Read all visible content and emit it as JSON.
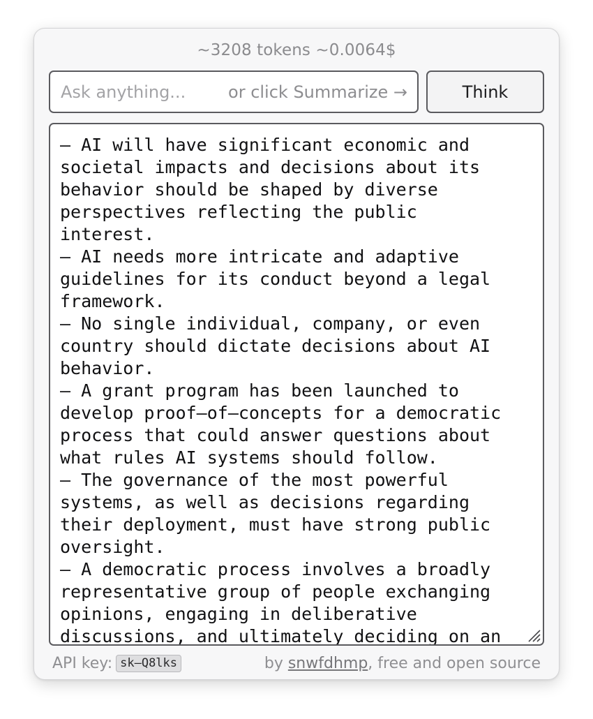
{
  "header": {
    "cost": "~3208 tokens ~0.0064$"
  },
  "ask": {
    "placeholder": "Ask anything...",
    "hint": "or click Summarize →"
  },
  "think_button": {
    "label": "Think"
  },
  "output": {
    "text": "– AI will have significant economic and\nsocietal impacts and decisions about its\nbehavior should be shaped by diverse\nperspectives reflecting the public\ninterest.\n– AI needs more intricate and adaptive\nguidelines for its conduct beyond a legal\nframework.\n– No single individual, company, or even\ncountry should dictate decisions about AI\nbehavior.\n– A grant program has been launched to\ndevelop proof–of–concepts for a democratic\nprocess that could answer questions about\nwhat rules AI systems should follow.\n– The governance of the most powerful\nsystems, as well as decisions regarding\ntheir deployment, must have strong public\noversight.\n– A democratic process involves a broadly\nrepresentative group of people exchanging\nopinions, engaging in deliberative\ndiscussions, and ultimately deciding on an"
  },
  "footer": {
    "api_label": "API key:",
    "api_key": "sk–Q8lks",
    "credit_prefix": "by ",
    "author": "snwfdhmp",
    "credit_suffix": ", free and open source"
  },
  "icons": {
    "resize": "resize-grip-icon"
  }
}
